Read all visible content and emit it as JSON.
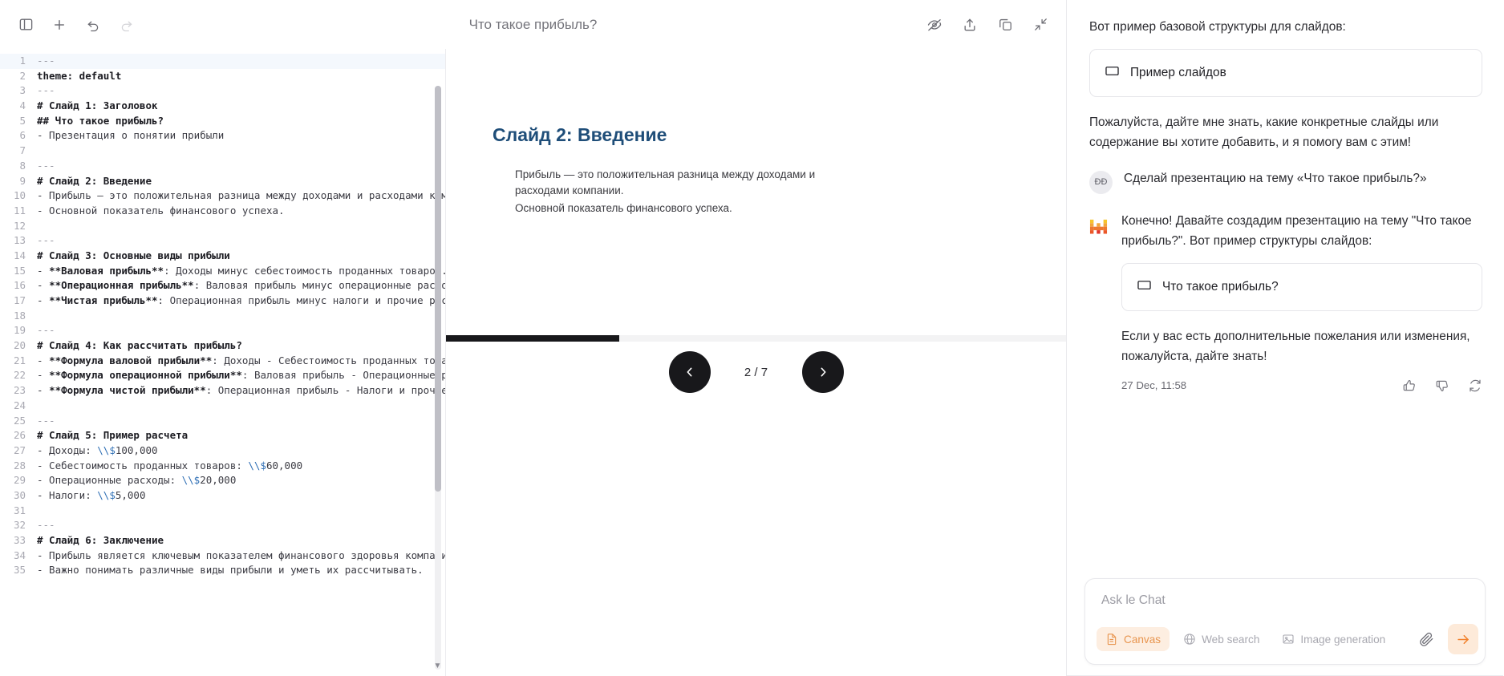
{
  "toolbar": {
    "sidebar_toggle": "toggle-sidebar",
    "new": "new",
    "undo": "undo",
    "redo": "redo",
    "title": "Что такое прибыль?",
    "hide": "hide-preview",
    "share": "share",
    "copy": "copy",
    "collapse": "collapse"
  },
  "editor": {
    "lines": [
      {
        "n": "1",
        "segs": [
          {
            "t": "---",
            "c": "d"
          }
        ],
        "hl": true
      },
      {
        "n": "2",
        "segs": [
          {
            "t": "theme: default",
            "c": "b"
          }
        ]
      },
      {
        "n": "3",
        "segs": [
          {
            "t": "---",
            "c": "d"
          }
        ]
      },
      {
        "n": "4",
        "segs": [
          {
            "t": "# Слайд 1: Заголовок",
            "c": "b"
          }
        ]
      },
      {
        "n": "5",
        "segs": [
          {
            "t": "## Что такое прибыль?",
            "c": "b"
          }
        ]
      },
      {
        "n": "6",
        "segs": [
          {
            "t": "- Презентация о понятии прибыли",
            "c": ""
          }
        ]
      },
      {
        "n": "7",
        "segs": [
          {
            "t": "",
            "c": ""
          }
        ]
      },
      {
        "n": "8",
        "segs": [
          {
            "t": "---",
            "c": "d"
          }
        ]
      },
      {
        "n": "9",
        "segs": [
          {
            "t": "# Слайд 2: Введение",
            "c": "b"
          }
        ]
      },
      {
        "n": "10",
        "segs": [
          {
            "t": "- Прибыль — это положительная разница между доходами и расходами ком",
            "c": ""
          }
        ]
      },
      {
        "n": "11",
        "segs": [
          {
            "t": "- Основной показатель финансового успеха.",
            "c": ""
          }
        ]
      },
      {
        "n": "12",
        "segs": [
          {
            "t": "",
            "c": ""
          }
        ]
      },
      {
        "n": "13",
        "segs": [
          {
            "t": "---",
            "c": "d"
          }
        ]
      },
      {
        "n": "14",
        "segs": [
          {
            "t": "# Слайд 3: Основные виды прибыли",
            "c": "b"
          }
        ]
      },
      {
        "n": "15",
        "segs": [
          {
            "t": "- ",
            "c": ""
          },
          {
            "t": "**Валовая прибыль**",
            "c": "b"
          },
          {
            "t": ": Доходы минус себестоимость проданных товаров.",
            "c": ""
          }
        ]
      },
      {
        "n": "16",
        "segs": [
          {
            "t": "- ",
            "c": ""
          },
          {
            "t": "**Операционная прибыль**",
            "c": "b"
          },
          {
            "t": ": Валовая прибыль минус операционные расхо",
            "c": ""
          }
        ]
      },
      {
        "n": "17",
        "segs": [
          {
            "t": "- ",
            "c": ""
          },
          {
            "t": "**Чистая прибыль**",
            "c": "b"
          },
          {
            "t": ": Операционная прибыль минус налоги и прочие рас",
            "c": ""
          }
        ]
      },
      {
        "n": "18",
        "segs": [
          {
            "t": "",
            "c": ""
          }
        ]
      },
      {
        "n": "19",
        "segs": [
          {
            "t": "---",
            "c": "d"
          }
        ]
      },
      {
        "n": "20",
        "segs": [
          {
            "t": "# Слайд 4: Как рассчитать прибыль?",
            "c": "b"
          }
        ]
      },
      {
        "n": "21",
        "segs": [
          {
            "t": "- ",
            "c": ""
          },
          {
            "t": "**Формула валовой прибыли**",
            "c": "b"
          },
          {
            "t": ": Доходы - Себестоимость проданных това",
            "c": ""
          }
        ]
      },
      {
        "n": "22",
        "segs": [
          {
            "t": "- ",
            "c": ""
          },
          {
            "t": "**Формула операционной прибыли**",
            "c": "b"
          },
          {
            "t": ": Валовая прибыль - Операционные р",
            "c": ""
          }
        ]
      },
      {
        "n": "23",
        "segs": [
          {
            "t": "- ",
            "c": ""
          },
          {
            "t": "**Формула чистой прибыли**",
            "c": "b"
          },
          {
            "t": ": Операционная прибыль - Налоги и прочие",
            "c": ""
          }
        ]
      },
      {
        "n": "24",
        "segs": [
          {
            "t": "",
            "c": ""
          }
        ]
      },
      {
        "n": "25",
        "segs": [
          {
            "t": "---",
            "c": "d"
          }
        ]
      },
      {
        "n": "26",
        "segs": [
          {
            "t": "# Слайд 5: Пример расчета",
            "c": "b"
          }
        ]
      },
      {
        "n": "27",
        "segs": [
          {
            "t": "- Доходы: ",
            "c": ""
          },
          {
            "t": "\\\\$",
            "c": "esc"
          },
          {
            "t": "100,000",
            "c": ""
          }
        ]
      },
      {
        "n": "28",
        "segs": [
          {
            "t": "- Себестоимость проданных товаров: ",
            "c": ""
          },
          {
            "t": "\\\\$",
            "c": "esc"
          },
          {
            "t": "60,000",
            "c": ""
          }
        ]
      },
      {
        "n": "29",
        "segs": [
          {
            "t": "- Операционные расходы: ",
            "c": ""
          },
          {
            "t": "\\\\$",
            "c": "esc"
          },
          {
            "t": "20,000",
            "c": ""
          }
        ]
      },
      {
        "n": "30",
        "segs": [
          {
            "t": "- Налоги: ",
            "c": ""
          },
          {
            "t": "\\\\$",
            "c": "esc"
          },
          {
            "t": "5,000",
            "c": ""
          }
        ]
      },
      {
        "n": "31",
        "segs": [
          {
            "t": "",
            "c": ""
          }
        ]
      },
      {
        "n": "32",
        "segs": [
          {
            "t": "---",
            "c": "d"
          }
        ]
      },
      {
        "n": "33",
        "segs": [
          {
            "t": "# Слайд 6: Заключение",
            "c": "b"
          }
        ]
      },
      {
        "n": "34",
        "segs": [
          {
            "t": "- Прибыль является ключевым показателем финансового здоровья компани",
            "c": ""
          }
        ]
      },
      {
        "n": "35",
        "segs": [
          {
            "t": "- Важно понимать различные виды прибыли и уметь их рассчитывать.",
            "c": ""
          }
        ]
      }
    ]
  },
  "slide": {
    "title": "Слайд 2: Введение",
    "bullets": [
      "Прибыль — это положительная разница между доходами и расходами компании.",
      "Основной показатель финансового успеха."
    ],
    "progress_percent": 28,
    "current": "2",
    "total": "7",
    "counter": "2 / 7",
    "prev_label": "‹",
    "next_label": "›"
  },
  "chat": {
    "messages": [
      {
        "role": "assistant",
        "intro": "Вот пример базовой структуры для слайдов:",
        "artifact": "Пример слайдов",
        "closing": "Пожалуйста, дайте мне знать, какие конкретные слайды или содержание вы хотите добавить, и я помогу вам с этим!"
      },
      {
        "role": "user",
        "avatar_initials": "ĐĐ",
        "text": "Сделай презентацию на тему «Что такое прибыль?»"
      },
      {
        "role": "assistant",
        "intro": "Конечно! Давайте создадим презентацию на тему \"Что такое прибыль?\". Вот пример структуры слайдов:",
        "artifact": "Что такое прибыль?",
        "closing": "Если у вас есть дополнительные пожелания или изменения, пожалуйста, дайте знать!",
        "timestamp": "27 Dec, 11:58",
        "actions": {
          "like": "thumbs-up",
          "dislike": "thumbs-down",
          "regenerate": "regenerate"
        }
      }
    ]
  },
  "composer": {
    "placeholder": "Ask le Chat",
    "chips": [
      {
        "label": "Canvas",
        "icon": "document-icon",
        "active": true
      },
      {
        "label": "Web search",
        "icon": "globe-icon",
        "active": false
      },
      {
        "label": "Image generation",
        "icon": "image-icon",
        "active": false
      }
    ],
    "attach": "attach-file",
    "send": "send"
  },
  "colors": {
    "accent": "#f2812c",
    "accent_bg": "#fdead9",
    "slide_heading": "#1f4e79",
    "nav_button": "#18181b",
    "escape_token": "#2f6fb5"
  }
}
